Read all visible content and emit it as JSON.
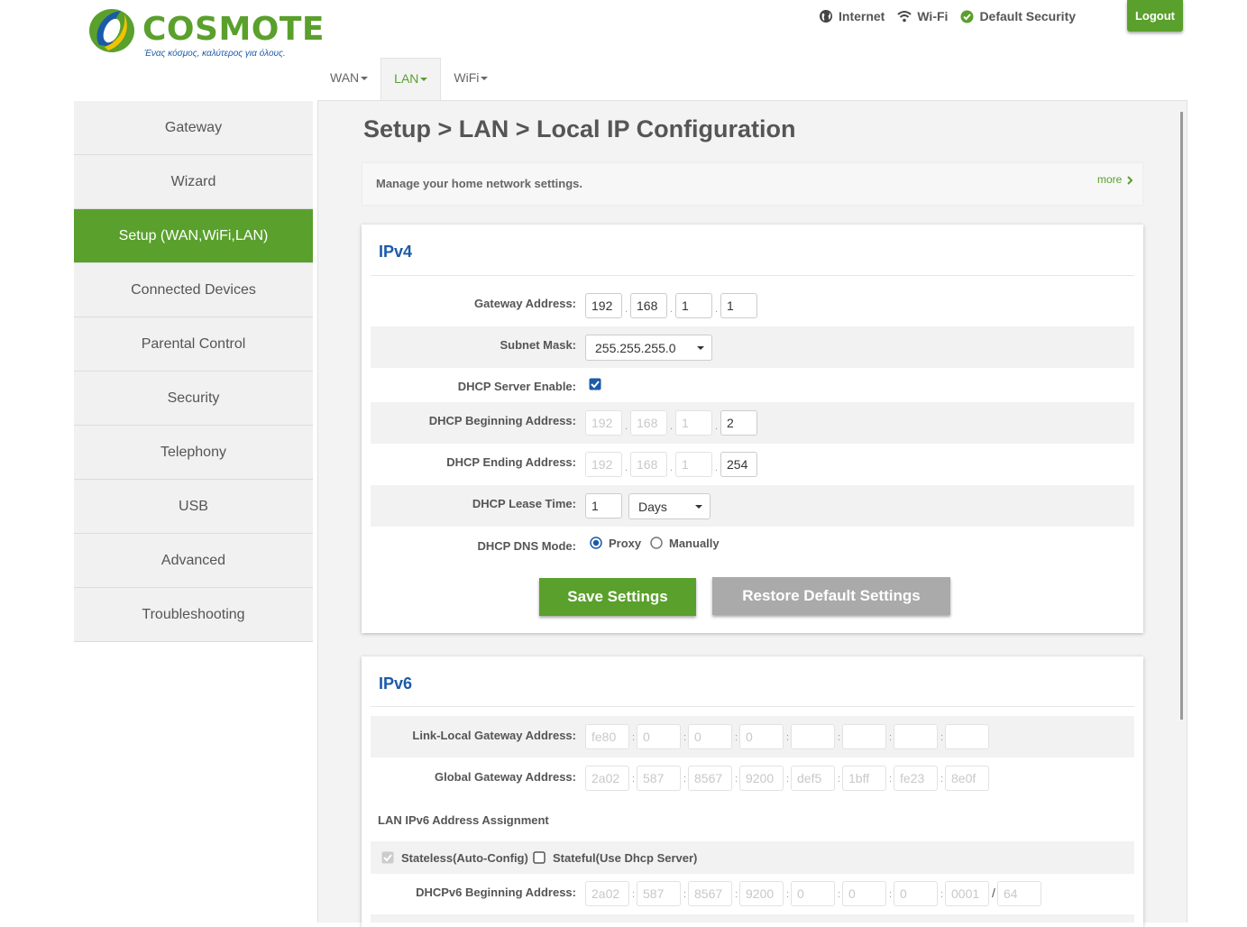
{
  "brand": {
    "name": "COSMOTE",
    "tagline": "Ένας κόσμος, καλύτερος για όλους."
  },
  "status": [
    {
      "label": "Internet",
      "icon": "globe-icon"
    },
    {
      "label": "Wi-Fi",
      "icon": "wifi-icon"
    },
    {
      "label": "Default Security",
      "icon": "check-circle-icon"
    }
  ],
  "logout_label": "Logout",
  "tabs": [
    {
      "label": "WAN"
    },
    {
      "label": "LAN"
    },
    {
      "label": "WiFi"
    }
  ],
  "sidebar": [
    {
      "label": "Gateway"
    },
    {
      "label": "Wizard"
    },
    {
      "label": "Setup (WAN,WiFi,LAN)"
    },
    {
      "label": "Connected Devices"
    },
    {
      "label": "Parental Control"
    },
    {
      "label": "Security"
    },
    {
      "label": "Telephony"
    },
    {
      "label": "USB"
    },
    {
      "label": "Advanced"
    },
    {
      "label": "Troubleshooting"
    }
  ],
  "page_title": "Setup > LAN > Local IP Configuration",
  "info": {
    "text": "Manage your home network settings.",
    "more": "more"
  },
  "ipv4": {
    "title": "IPv4",
    "gateway_label": "Gateway Address:",
    "gateway": [
      "192",
      "168",
      "1",
      "1"
    ],
    "subnet_label": "Subnet Mask:",
    "subnet": "255.255.255.0",
    "dhcp_enable_label": "DHCP Server Enable:",
    "dhcp_enabled": true,
    "dhcp_begin_label": "DHCP Beginning Address:",
    "dhcp_begin": [
      "192",
      "168",
      "1",
      "2"
    ],
    "dhcp_end_label": "DHCP Ending Address:",
    "dhcp_end": [
      "192",
      "168",
      "1",
      "254"
    ],
    "lease_label": "DHCP Lease Time:",
    "lease_value": "1",
    "lease_unit": "Days",
    "dns_label": "DHCP DNS Mode:",
    "dns_proxy": "Proxy",
    "dns_manual": "Manually",
    "dns_selected": "Proxy",
    "save": "Save Settings",
    "restore": "Restore Default Settings"
  },
  "ipv6": {
    "title": "IPv6",
    "link_local_label": "Link-Local Gateway Address:",
    "link_local": [
      "fe80",
      "0",
      "0",
      "0",
      "",
      "",
      "",
      ""
    ],
    "global_label": "Global Gateway Address:",
    "global": [
      "2a02",
      "587",
      "8567",
      "9200",
      "def5",
      "1bff",
      "fe23",
      "8e0f"
    ],
    "assignment_label": "LAN IPv6 Address Assignment",
    "stateless": "Stateless(Auto-Config)",
    "stateful": "Stateful(Use Dhcp Server)",
    "dhcpv6_begin_label": "DHCPv6 Beginning Address:",
    "dhcpv6_begin": [
      "2a02",
      "587",
      "8567",
      "9200",
      "0",
      "0",
      "0",
      "0001"
    ],
    "prefix": "64"
  },
  "colors": {
    "brand_green": "#5aa02c",
    "brand_blue": "#1c5aa8"
  }
}
